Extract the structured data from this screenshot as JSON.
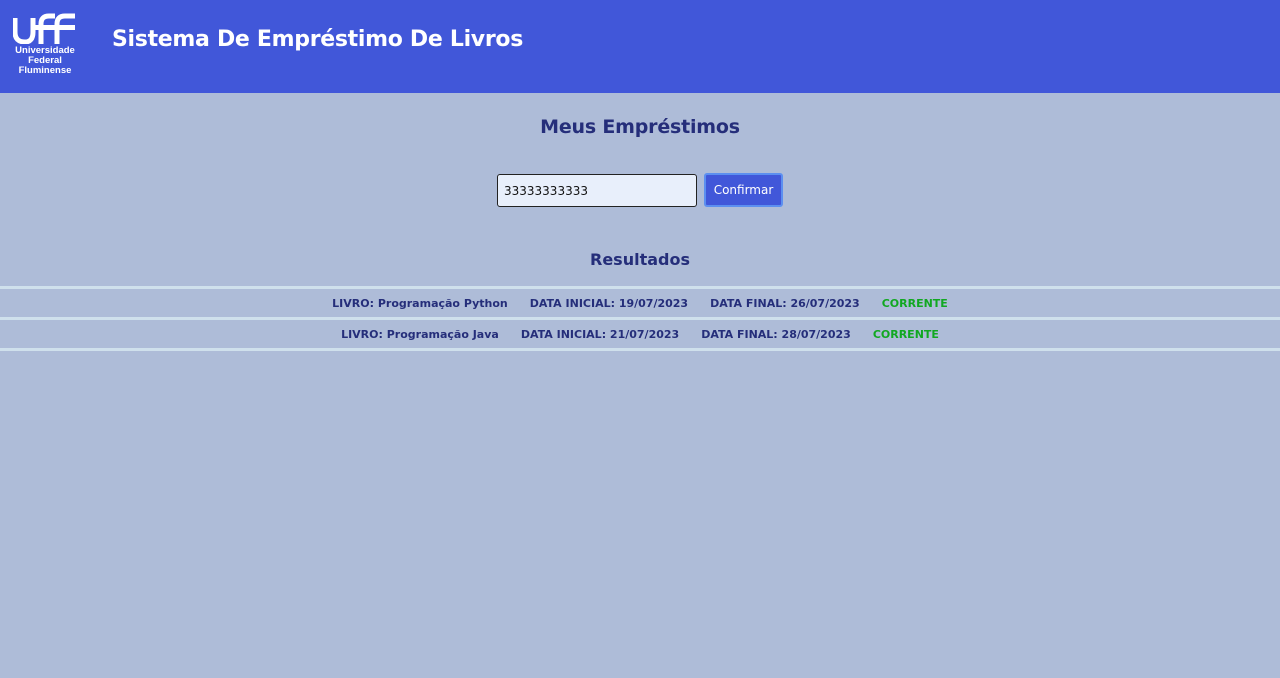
{
  "header": {
    "logo": {
      "mark": "uff",
      "line1": "Universidade",
      "line2": "Federal",
      "line3": "Fluminense"
    },
    "title": "Sistema De Empréstimo De Livros"
  },
  "main": {
    "page_title": "Meus Empréstimos",
    "search": {
      "value": "33333333333",
      "button_label": "Confirmar"
    },
    "results_title": "Resultados",
    "results": [
      {
        "livro": "LIVRO: Programação Python",
        "data_inicial": "DATA INICIAL: 19/07/2023",
        "data_final": "DATA FINAL: 26/07/2023",
        "status": "CORRENTE"
      },
      {
        "livro": "LIVRO: Programação Java",
        "data_inicial": "DATA INICIAL: 21/07/2023",
        "data_final": "DATA FINAL: 28/07/2023",
        "status": "CORRENTE"
      }
    ]
  },
  "colors": {
    "header_bg": "#4157d9",
    "page_bg": "#aebcd8",
    "title_text": "#252e7a",
    "status_ok": "#11a821"
  }
}
